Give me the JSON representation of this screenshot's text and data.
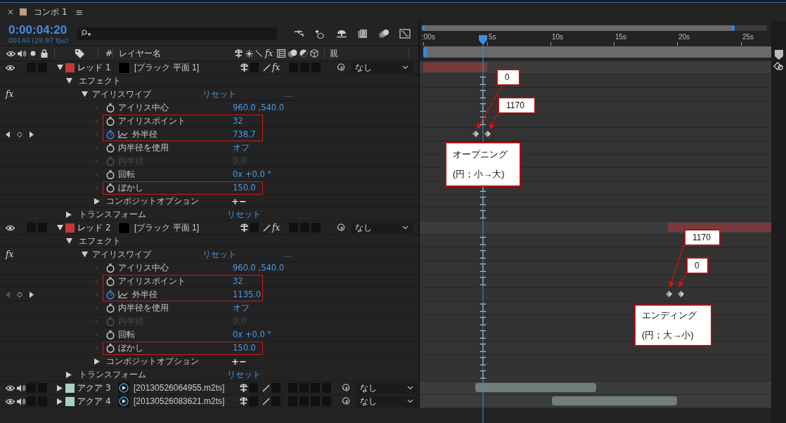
{
  "tab": {
    "close": "×",
    "title": "コンポ 1",
    "menu": "≡"
  },
  "timecode": "0:00:04:20",
  "frame_info": "00140 (29.97 fps)",
  "columns": {
    "number": "#",
    "layer_name": "レイヤー名",
    "fx": "fx",
    "parent": "親"
  },
  "ruler": [
    ":00s",
    "5s",
    "10s",
    "15s",
    "20s",
    "25s"
  ],
  "layers": [
    {
      "label": "レッド",
      "number": "1",
      "color": "#c4393c",
      "source": "[ブラック 平面 1]",
      "kind": "solid",
      "audio": false,
      "expanded": true,
      "fx": "fx",
      "parent": "なし",
      "effects": {
        "label": "エフェクト",
        "expanded": true,
        "effect": {
          "badge": "fx",
          "name": "アイリスワイプ",
          "expanded": true,
          "reset": "リセット",
          "more": "...",
          "properties": [
            {
              "name": "アイリス中心",
              "value": "960.0 ,540.0",
              "animated": false,
              "disabled": false,
              "boxed": false
            },
            {
              "name": "アイリスポイント",
              "value": "32",
              "animated": false,
              "disabled": false,
              "boxed": true
            },
            {
              "name": "外半径",
              "value": "738.7",
              "animated": true,
              "prev_key": true,
              "disabled": false,
              "boxed": true
            },
            {
              "name": "内半径を使用",
              "value": "オフ",
              "animated": false,
              "disabled": false,
              "boxed": false
            },
            {
              "name": "内半径",
              "value": "0.0",
              "animated": false,
              "disabled": true,
              "boxed": false
            },
            {
              "name": "回転",
              "value": "0x +0.0 °",
              "animated": false,
              "disabled": false,
              "boxed": false
            },
            {
              "name": "ぼかし",
              "value": "150.0",
              "animated": false,
              "disabled": false,
              "boxed": true
            }
          ],
          "composite": {
            "label": "コンポジットオプション",
            "value": "+−",
            "expanded": false
          }
        }
      },
      "transform": {
        "label": "トランスフォーム",
        "reset": "リセット",
        "expanded": false
      }
    },
    {
      "label": "レッド",
      "number": "2",
      "color": "#c4393c",
      "source": "[ブラック 平面 1]",
      "kind": "solid",
      "audio": false,
      "expanded": true,
      "fx": "fx",
      "parent": "なし",
      "effects": {
        "label": "エフェクト",
        "expanded": true,
        "effect": {
          "badge": "fx",
          "name": "アイリスワイプ",
          "expanded": true,
          "reset": "リセット",
          "more": "...",
          "properties": [
            {
              "name": "アイリス中心",
              "value": "960.0 ,540.0",
              "animated": false,
              "disabled": false,
              "boxed": false
            },
            {
              "name": "アイリスポイント",
              "value": "32",
              "animated": false,
              "disabled": false,
              "boxed": true
            },
            {
              "name": "外半径",
              "value": "1135.0",
              "animated": true,
              "prev_key": false,
              "disabled": false,
              "boxed": true
            },
            {
              "name": "内半径を使用",
              "value": "オフ",
              "animated": false,
              "disabled": false,
              "boxed": false
            },
            {
              "name": "内半径",
              "value": "0.0",
              "animated": false,
              "disabled": true,
              "boxed": false
            },
            {
              "name": "回転",
              "value": "0x +0.0 °",
              "animated": false,
              "disabled": false,
              "boxed": false
            },
            {
              "name": "ぼかし",
              "value": "150.0",
              "animated": false,
              "disabled": false,
              "boxed": true
            }
          ],
          "composite": {
            "label": "コンポジットオプション",
            "value": "+−",
            "expanded": false
          }
        }
      },
      "transform": {
        "label": "トランスフォーム",
        "reset": "リセット",
        "expanded": false
      }
    },
    {
      "label": "アクア",
      "number": "3",
      "color": "#a9d0c8",
      "source": "[20130526064955.m2ts]",
      "kind": "footage",
      "audio": true,
      "expanded": false,
      "parent": "なし"
    },
    {
      "label": "アクア",
      "number": "4",
      "color": "#a9d0c8",
      "source": "[20130526083621.m2ts]",
      "kind": "footage",
      "audio": true,
      "expanded": false,
      "parent": "なし"
    }
  ],
  "callouts": [
    {
      "kind": "value",
      "text": "0"
    },
    {
      "kind": "value",
      "text": "1170"
    },
    {
      "kind": "note",
      "lines": [
        "オープニング",
        "(円；小→大)"
      ]
    },
    {
      "kind": "value",
      "text": "1170"
    },
    {
      "kind": "value",
      "text": "0"
    },
    {
      "kind": "note",
      "lines": [
        "エンディング",
        "(円；大→小)"
      ]
    }
  ]
}
